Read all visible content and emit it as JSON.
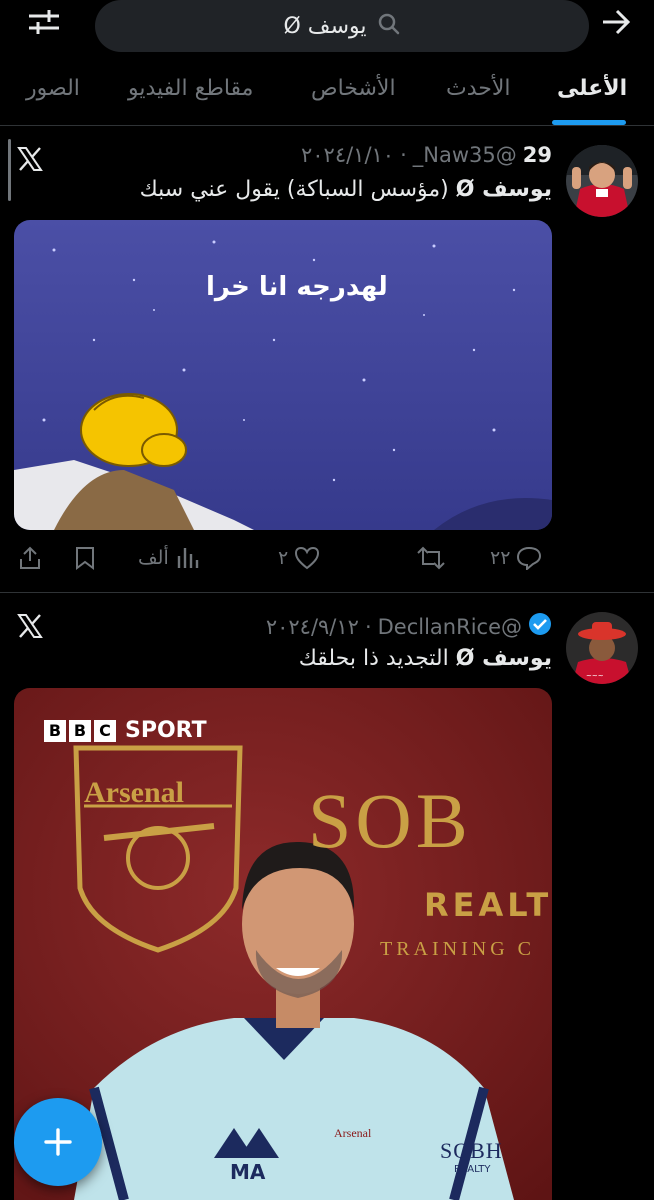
{
  "search": {
    "query": "يوسف Ø"
  },
  "tabs": [
    {
      "label": "الأعلى",
      "active": true
    },
    {
      "label": "الأحدث",
      "active": false
    },
    {
      "label": "الأشخاص",
      "active": false
    },
    {
      "label": "مقاطع الفيديو",
      "active": false
    },
    {
      "label": "الصور",
      "active": false
    }
  ],
  "tweets": [
    {
      "display_name": "29",
      "handle": "@Naw35_",
      "date": "٢٠٢٤/١/١٠",
      "text_bold": "يوسف Ø",
      "text_rest": "(مؤسس السباكة) يقول عني سبك",
      "media_caption": "لهدرجه انا خرا",
      "replies": "٢٢",
      "retweets": "",
      "likes": "٢",
      "views": "ألف",
      "verified": false
    },
    {
      "display_name": "",
      "handle": "@DecllanRice",
      "date": "٢٠٢٤/٩/١٢",
      "text_bold": "يوسف Ø",
      "text_rest": "التجديد ذا بحلقك",
      "media_brand": "SPORT",
      "media_bbc": [
        "B",
        "B",
        "C"
      ],
      "media_club": "Arsenal",
      "media_sponsor": "SOB",
      "media_sponsor_sub": "REALT",
      "media_training": "TRAINING C",
      "shirt_initials": "MA",
      "shirt_badge": "Arsenal",
      "shirt_sponsor": "SOBH",
      "shirt_sponsor_sub": "REALTY",
      "verified": true
    }
  ],
  "colors": {
    "accent": "#1d9bf0",
    "muted": "#71767b",
    "text": "#e7e9ea",
    "background": "#000000"
  }
}
